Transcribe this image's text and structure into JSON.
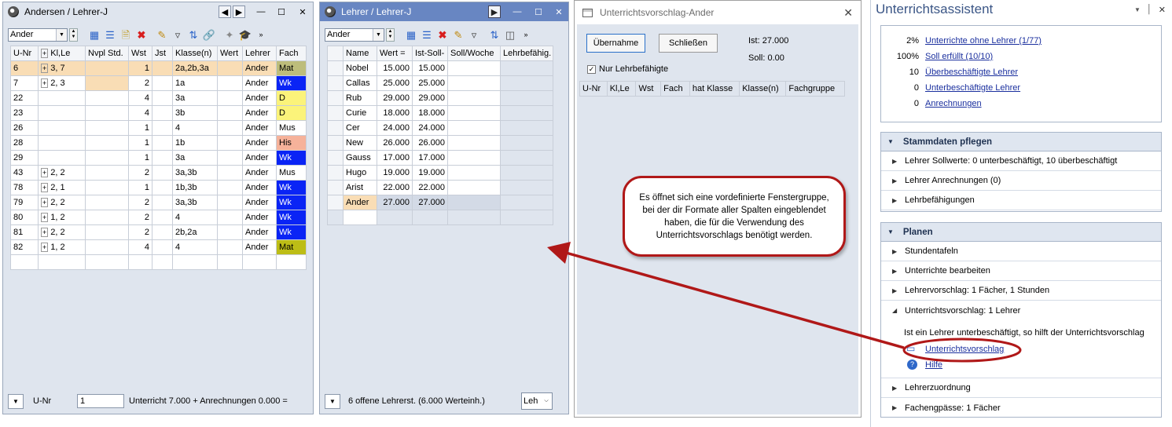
{
  "win1": {
    "title": "Andersen / Lehrer-J",
    "combo": "Ander",
    "columns": [
      "U-Nr",
      "Kl,Le",
      "Nvpl Std.",
      "Wst",
      "Jst",
      "Klasse(n)",
      "Wert",
      "Lehrer",
      "Fach"
    ],
    "rows": [
      {
        "unr": "6",
        "kl": "3, 7",
        "nvpl": "",
        "wst": "1",
        "jst": "",
        "klasse": "2a,2b,3a",
        "wert": "",
        "lehrer": "Ander",
        "fach": "Mat",
        "fc": "#bdbd7b"
      },
      {
        "unr": "7",
        "kl": "2, 3",
        "nvpl": "",
        "wst": "2",
        "jst": "",
        "klasse": "1a",
        "wert": "",
        "lehrer": "Ander",
        "fach": "Wk",
        "fc": "#0a24f5"
      },
      {
        "unr": "22",
        "kl": "",
        "nvpl": "",
        "wst": "4",
        "jst": "",
        "klasse": "3a",
        "wert": "",
        "lehrer": "Ander",
        "fach": "D",
        "fc": "#fbf37a"
      },
      {
        "unr": "23",
        "kl": "",
        "nvpl": "",
        "wst": "4",
        "jst": "",
        "klasse": "3b",
        "wert": "",
        "lehrer": "Ander",
        "fach": "D",
        "fc": "#fbf37a"
      },
      {
        "unr": "26",
        "kl": "",
        "nvpl": "",
        "wst": "1",
        "jst": "",
        "klasse": "4",
        "wert": "",
        "lehrer": "Ander",
        "fach": "Mus",
        "fc": "#ffffff"
      },
      {
        "unr": "28",
        "kl": "",
        "nvpl": "",
        "wst": "1",
        "jst": "",
        "klasse": "1b",
        "wert": "",
        "lehrer": "Ander",
        "fach": "His",
        "fc": "#f6b29a"
      },
      {
        "unr": "29",
        "kl": "",
        "nvpl": "",
        "wst": "1",
        "jst": "",
        "klasse": "3a",
        "wert": "",
        "lehrer": "Ander",
        "fach": "Wk",
        "fc": "#0a24f5"
      },
      {
        "unr": "43",
        "kl": "2, 2",
        "nvpl": "",
        "wst": "2",
        "jst": "",
        "klasse": "3a,3b",
        "wert": "",
        "lehrer": "Ander",
        "fach": "Mus",
        "fc": "#ffffff"
      },
      {
        "unr": "78",
        "kl": "2, 1",
        "nvpl": "",
        "wst": "1",
        "jst": "",
        "klasse": "1b,3b",
        "wert": "",
        "lehrer": "Ander",
        "fach": "Wk",
        "fc": "#0a24f5"
      },
      {
        "unr": "79",
        "kl": "2, 2",
        "nvpl": "",
        "wst": "2",
        "jst": "",
        "klasse": "3a,3b",
        "wert": "",
        "lehrer": "Ander",
        "fach": "Wk",
        "fc": "#0a24f5"
      },
      {
        "unr": "80",
        "kl": "1, 2",
        "nvpl": "",
        "wst": "2",
        "jst": "",
        "klasse": "4",
        "wert": "",
        "lehrer": "Ander",
        "fach": "Wk",
        "fc": "#0a24f5"
      },
      {
        "unr": "81",
        "kl": "2, 2",
        "nvpl": "",
        "wst": "2",
        "jst": "",
        "klasse": "2b,2a",
        "wert": "",
        "lehrer": "Ander",
        "fach": "Wk",
        "fc": "#0a24f5"
      },
      {
        "unr": "82",
        "kl": "1, 2",
        "nvpl": "",
        "wst": "4",
        "jst": "",
        "klasse": "4",
        "wert": "",
        "lehrer": "Ander",
        "fach": "Mat",
        "fc": "#bdbd16"
      }
    ],
    "status_field": "U-Nr",
    "status_value": "1",
    "status_text": "Unterricht 7.000 + Anrechnungen 0.000 ="
  },
  "win2": {
    "title": "Lehrer / Lehrer-J",
    "combo": "Ander",
    "columns": [
      "Name",
      "Wert =",
      "Ist-Soll-",
      "Soll/Woche",
      "Lehrbefähig."
    ],
    "rows": [
      {
        "name": "Nobel",
        "wert": "15.000",
        "ist": "15.000"
      },
      {
        "name": "Callas",
        "wert": "25.000",
        "ist": "25.000"
      },
      {
        "name": "Rub",
        "wert": "29.000",
        "ist": "29.000"
      },
      {
        "name": "Curie",
        "wert": "18.000",
        "ist": "18.000"
      },
      {
        "name": "Cer",
        "wert": "24.000",
        "ist": "24.000"
      },
      {
        "name": "New",
        "wert": "26.000",
        "ist": "26.000"
      },
      {
        "name": "Gauss",
        "wert": "17.000",
        "ist": "17.000"
      },
      {
        "name": "Hugo",
        "wert": "19.000",
        "ist": "19.000"
      },
      {
        "name": "Arist",
        "wert": "22.000",
        "ist": "22.000"
      },
      {
        "name": "Ander",
        "wert": "27.000",
        "ist": "27.000"
      }
    ],
    "status_text": "6 offene Lehrerst. (6.000 Werteinh.)",
    "status_combo": "Leh"
  },
  "win3": {
    "title": "Unterrichtsvorschlag-Ander",
    "btn_accept": "Übernahme",
    "btn_close": "Schließen",
    "ist": "Ist: 27.000",
    "soll": "Soll: 0.00",
    "checkbox": "Nur Lehrbefähigte",
    "columns": [
      "U-Nr",
      "Kl,Le",
      "Wst",
      "Fach",
      "hat Klasse",
      "Klasse(n)",
      "Fachgruppe"
    ]
  },
  "callout": {
    "text": "Es öffnet sich eine vordefinierte Fenstergruppe, bei der dir Formate aller Spalten eingeblendet haben, die für die Verwendung des Unterrichtsvorschlags benötigt werden."
  },
  "assistant": {
    "title": "Unterrichtsassistent",
    "stats": [
      {
        "value": "2%",
        "label": "Unterrichte ohne Lehrer (1/77)"
      },
      {
        "value": "100%",
        "label": "Soll erfüllt (10/10)"
      },
      {
        "value": "10",
        "label": "Überbeschäftigte Lehrer"
      },
      {
        "value": "0",
        "label": "Unterbeschäftigte Lehrer"
      },
      {
        "value": "0",
        "label": "Anrechnungen"
      }
    ],
    "stamm_title": "Stammdaten pflegen",
    "stamm_items": [
      "Lehrer Sollwerte: 0 unterbeschäftigt, 10 überbeschäftigt",
      "Lehrer Anrechnungen (0)",
      "Lehrbefähigungen"
    ],
    "planen_title": "Planen",
    "planen_items": [
      "Stundentafeln",
      "Unterrichte bearbeiten",
      "Lehrervorschlag: 1 Fächer, 1 Stunden"
    ],
    "uv_title": "Unterrichtsvorschlag: 1 Lehrer",
    "uv_desc": "Ist ein Lehrer unterbeschäftigt, so hilft der Unterrichtsvorschlag",
    "uv_link": "Unterrichtsvorschlag",
    "help_link": "Hilfe",
    "bottom_items": [
      "Lehrerzuordnung",
      "Fachengpässe: 1 Fächer"
    ]
  }
}
